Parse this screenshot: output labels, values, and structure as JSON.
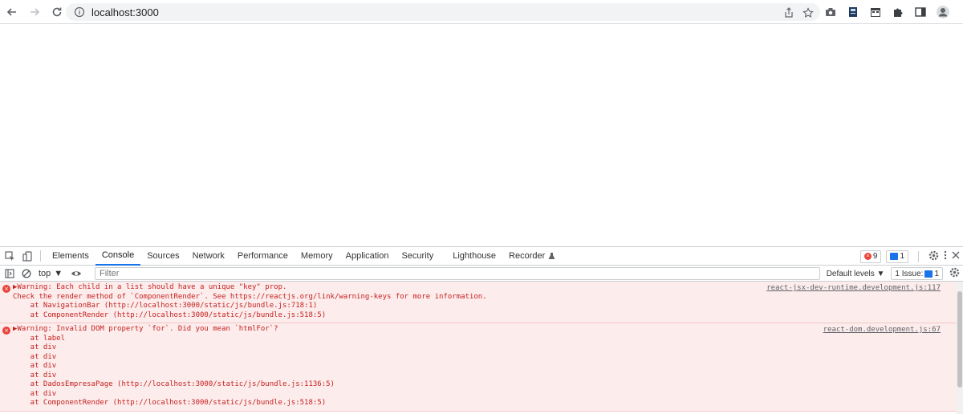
{
  "browser": {
    "url": "localhost:3000"
  },
  "devtools": {
    "tabs": [
      "Elements",
      "Console",
      "Sources",
      "Network",
      "Performance",
      "Memory",
      "Application",
      "Security",
      "Lighthouse",
      "Recorder"
    ],
    "error_count": "9",
    "info_count": "1",
    "context": "top",
    "filter_placeholder": "Filter",
    "levels": "Default levels",
    "issues_label": "1 Issue:",
    "issues_count": "1"
  },
  "console": {
    "messages": [
      {
        "source": "react-jsx-dev-runtime.development.js:117",
        "lines": [
          "▶Warning: Each child in a list should have a unique \"key\" prop.",
          "",
          "Check the render method of `ComponentRender`. See https://reactjs.org/link/warning-keys for more information.",
          "    at NavigationBar (http://localhost:3000/static/js/bundle.js:718:1)",
          "    at ComponentRender (http://localhost:3000/static/js/bundle.js:518:5)"
        ]
      },
      {
        "source": "react-dom.development.js:67",
        "lines": [
          "▶Warning: Invalid DOM property `for`. Did you mean `htmlFor`?",
          "    at label",
          "    at div",
          "    at div",
          "    at div",
          "    at div",
          "    at DadosEmpresaPage (http://localhost:3000/static/js/bundle.js:1136:5)",
          "    at div",
          "    at ComponentRender (http://localhost:3000/static/js/bundle.js:518:5)"
        ]
      }
    ]
  },
  "colors": {
    "accent": "#1a73e8",
    "error_text": "#c5221f",
    "error_bg": "#fcecec"
  }
}
